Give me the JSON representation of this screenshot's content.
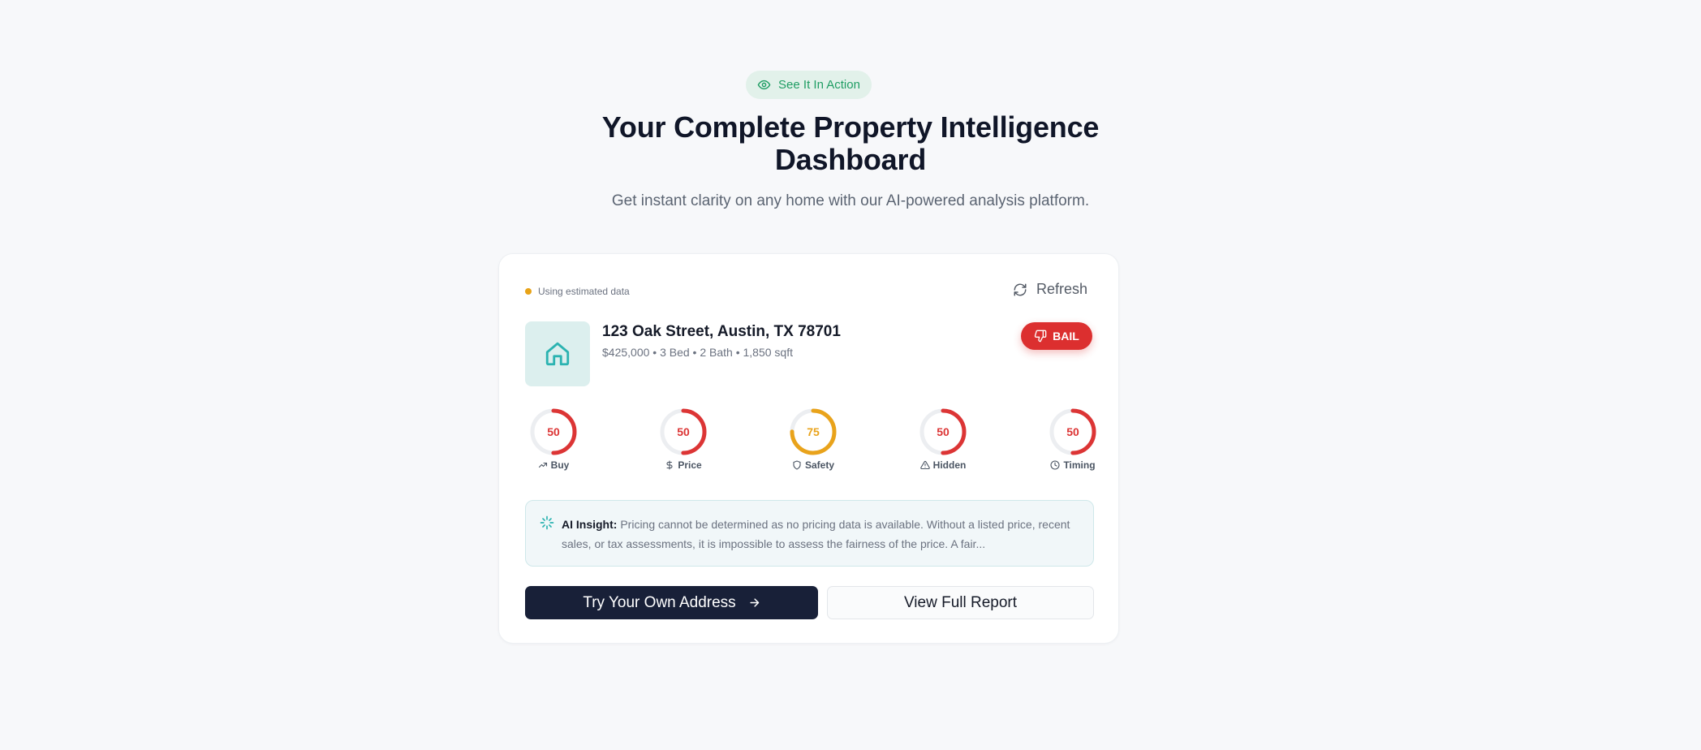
{
  "hero": {
    "badge": "See It In Action",
    "title_line1": "Your Complete Property Intelligence",
    "title_line2": "Dashboard",
    "subtitle": "Get instant clarity on any home with our AI-powered analysis platform."
  },
  "card": {
    "status_text": "Using estimated data",
    "status_color": "#e8a317",
    "refresh_label": "Refresh",
    "property": {
      "address": "123 Oak Street, Austin, TX 78701",
      "details": "$425,000 • 3 Bed • 2 Bath • 1,850 sqft"
    },
    "verdict": {
      "label": "BAIL",
      "color": "#dc2f2f"
    },
    "scores": [
      {
        "label": "Buy",
        "value": 50,
        "max": 100,
        "color": "#dc3535",
        "icon": "trending-up-icon"
      },
      {
        "label": "Price",
        "value": 50,
        "max": 100,
        "color": "#dc3535",
        "icon": "dollar-icon"
      },
      {
        "label": "Safety",
        "value": 75,
        "max": 100,
        "color": "#e9a31b",
        "icon": "shield-icon"
      },
      {
        "label": "Hidden",
        "value": 50,
        "max": 100,
        "color": "#dc3535",
        "icon": "warning-icon"
      },
      {
        "label": "Timing",
        "value": 50,
        "max": 100,
        "color": "#dc3535",
        "icon": "clock-icon"
      }
    ],
    "insight": {
      "heading": "AI Insight:",
      "text": "Pricing cannot be determined as no pricing data is available. Without a listed price, recent sales, or tax assessments, it is impossible to assess the fairness of the price. A fair..."
    },
    "primary_button": "Try Your Own Address",
    "secondary_button": "View Full Report"
  }
}
